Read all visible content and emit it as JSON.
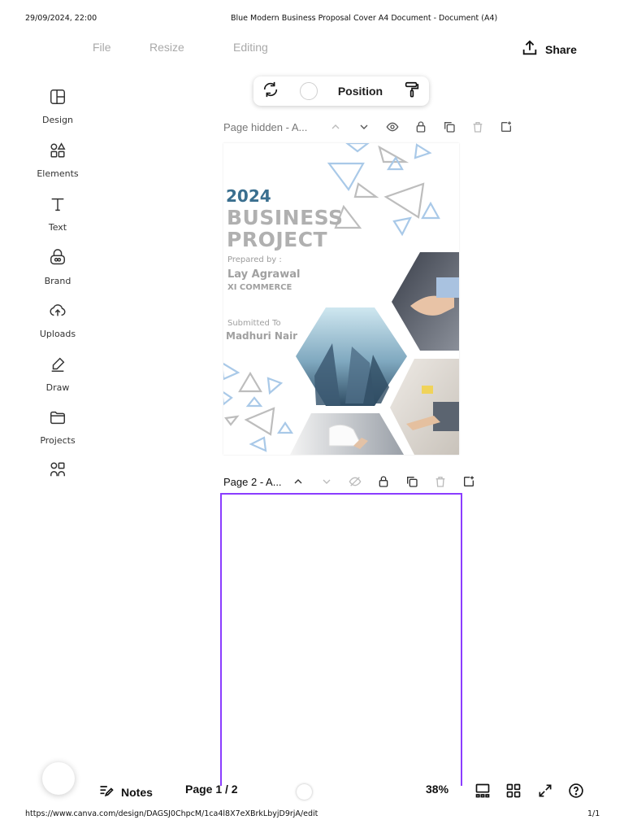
{
  "print_header": {
    "datetime": "29/09/2024, 22:00",
    "doc_title": "Blue Modern Business Proposal Cover A4 Document - Document (A4)"
  },
  "menu": {
    "file": "File",
    "resize": "Resize",
    "editing": "Editing",
    "share": "Share"
  },
  "sidebar": {
    "items": [
      {
        "label": "Design",
        "icon": "layout-icon"
      },
      {
        "label": "Elements",
        "icon": "shapes-icon"
      },
      {
        "label": "Text",
        "icon": "text-icon"
      },
      {
        "label": "Brand",
        "icon": "brand-icon"
      },
      {
        "label": "Uploads",
        "icon": "cloud-upload-icon"
      },
      {
        "label": "Draw",
        "icon": "pen-icon"
      },
      {
        "label": "Projects",
        "icon": "folder-icon"
      },
      {
        "label": "",
        "icon": "apps-icon"
      }
    ]
  },
  "context_toolbar": {
    "position_label": "Position"
  },
  "page1": {
    "label": "Page hidden - A..."
  },
  "page2": {
    "label": "Page 2 - A..."
  },
  "cover": {
    "year": "2024",
    "title_line1": "BUSINESS",
    "title_line2": "PROJECT",
    "prepared_label": "Prepared by :",
    "author": "Lay Agrawal",
    "author_class": "XI COMMERCE",
    "submitted_label": "Submitted To",
    "submitted_name": "Madhuri Nair",
    "colors": {
      "year": "#3a6f8f",
      "title": "#b0b0b0",
      "accent": "#a9c9e8"
    }
  },
  "footer": {
    "notes": "Notes",
    "page_indicator": "Page 1 / 2",
    "zoom": "38%",
    "url": "https://www.canva.com/design/DAGSJ0ChpcM/1ca4l8X7eXBrkLbyjD9rjA/edit",
    "print_page": "1/1"
  },
  "colors": {
    "page2_border": "#8b3dff"
  }
}
